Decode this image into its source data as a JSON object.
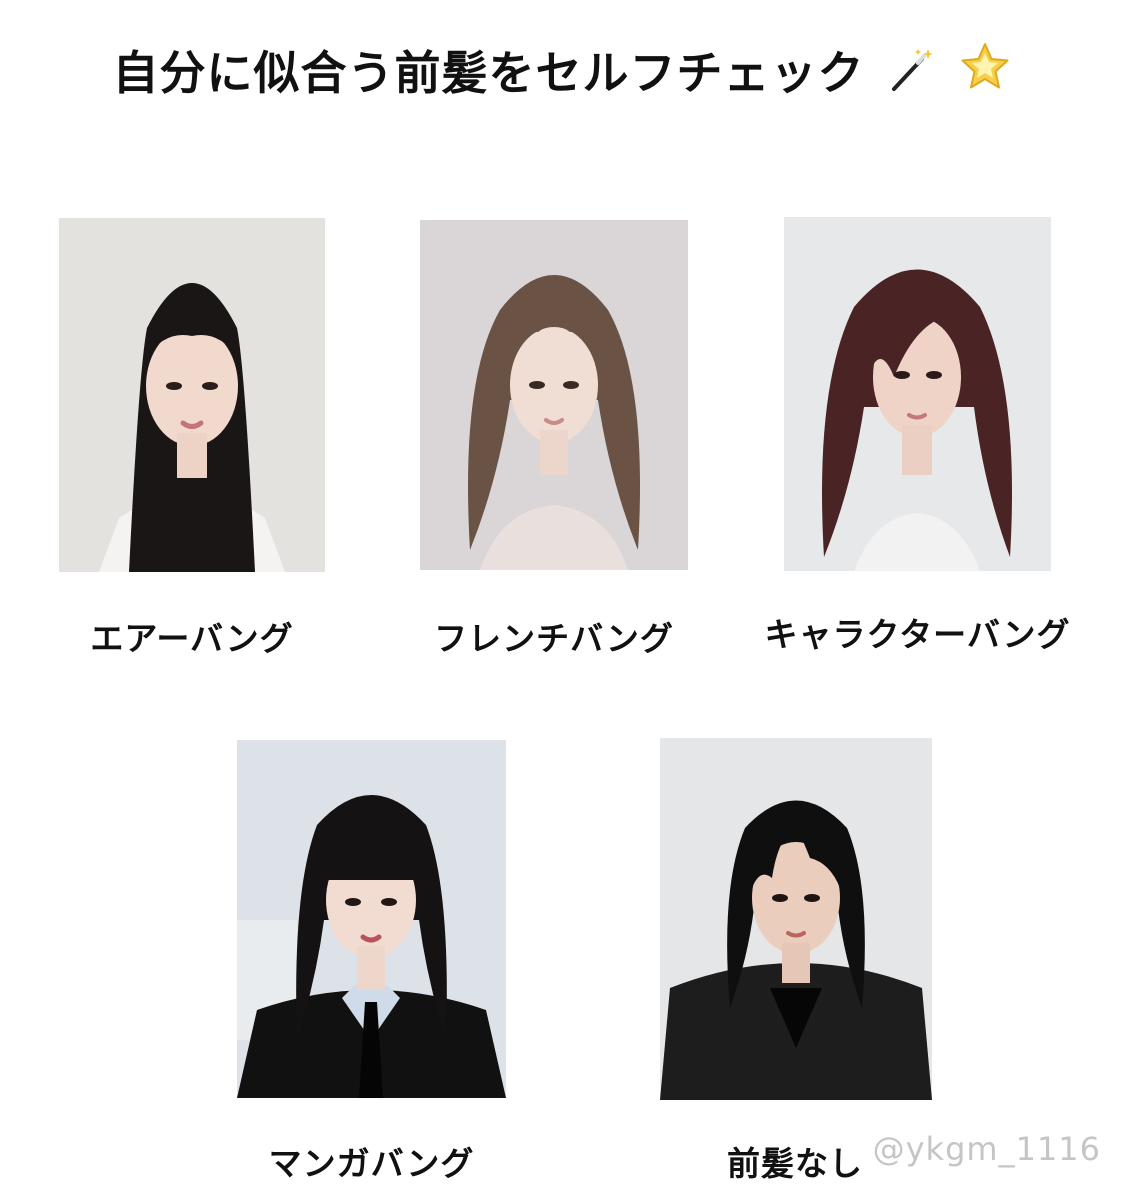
{
  "title": "自分に似合う前髪をセルフチェック",
  "title_icons": [
    "magic-wand-icon",
    "star-icon"
  ],
  "styles": [
    {
      "label": "エアーバング"
    },
    {
      "label": "フレンチバング"
    },
    {
      "label": "キャラクターバング"
    },
    {
      "label": "マンガバング"
    },
    {
      "label": "前髪なし"
    }
  ],
  "watermark": "@ykgm_1116",
  "colors": {
    "text": "#111111",
    "star": "#f5c531",
    "watermark": "#969696"
  }
}
